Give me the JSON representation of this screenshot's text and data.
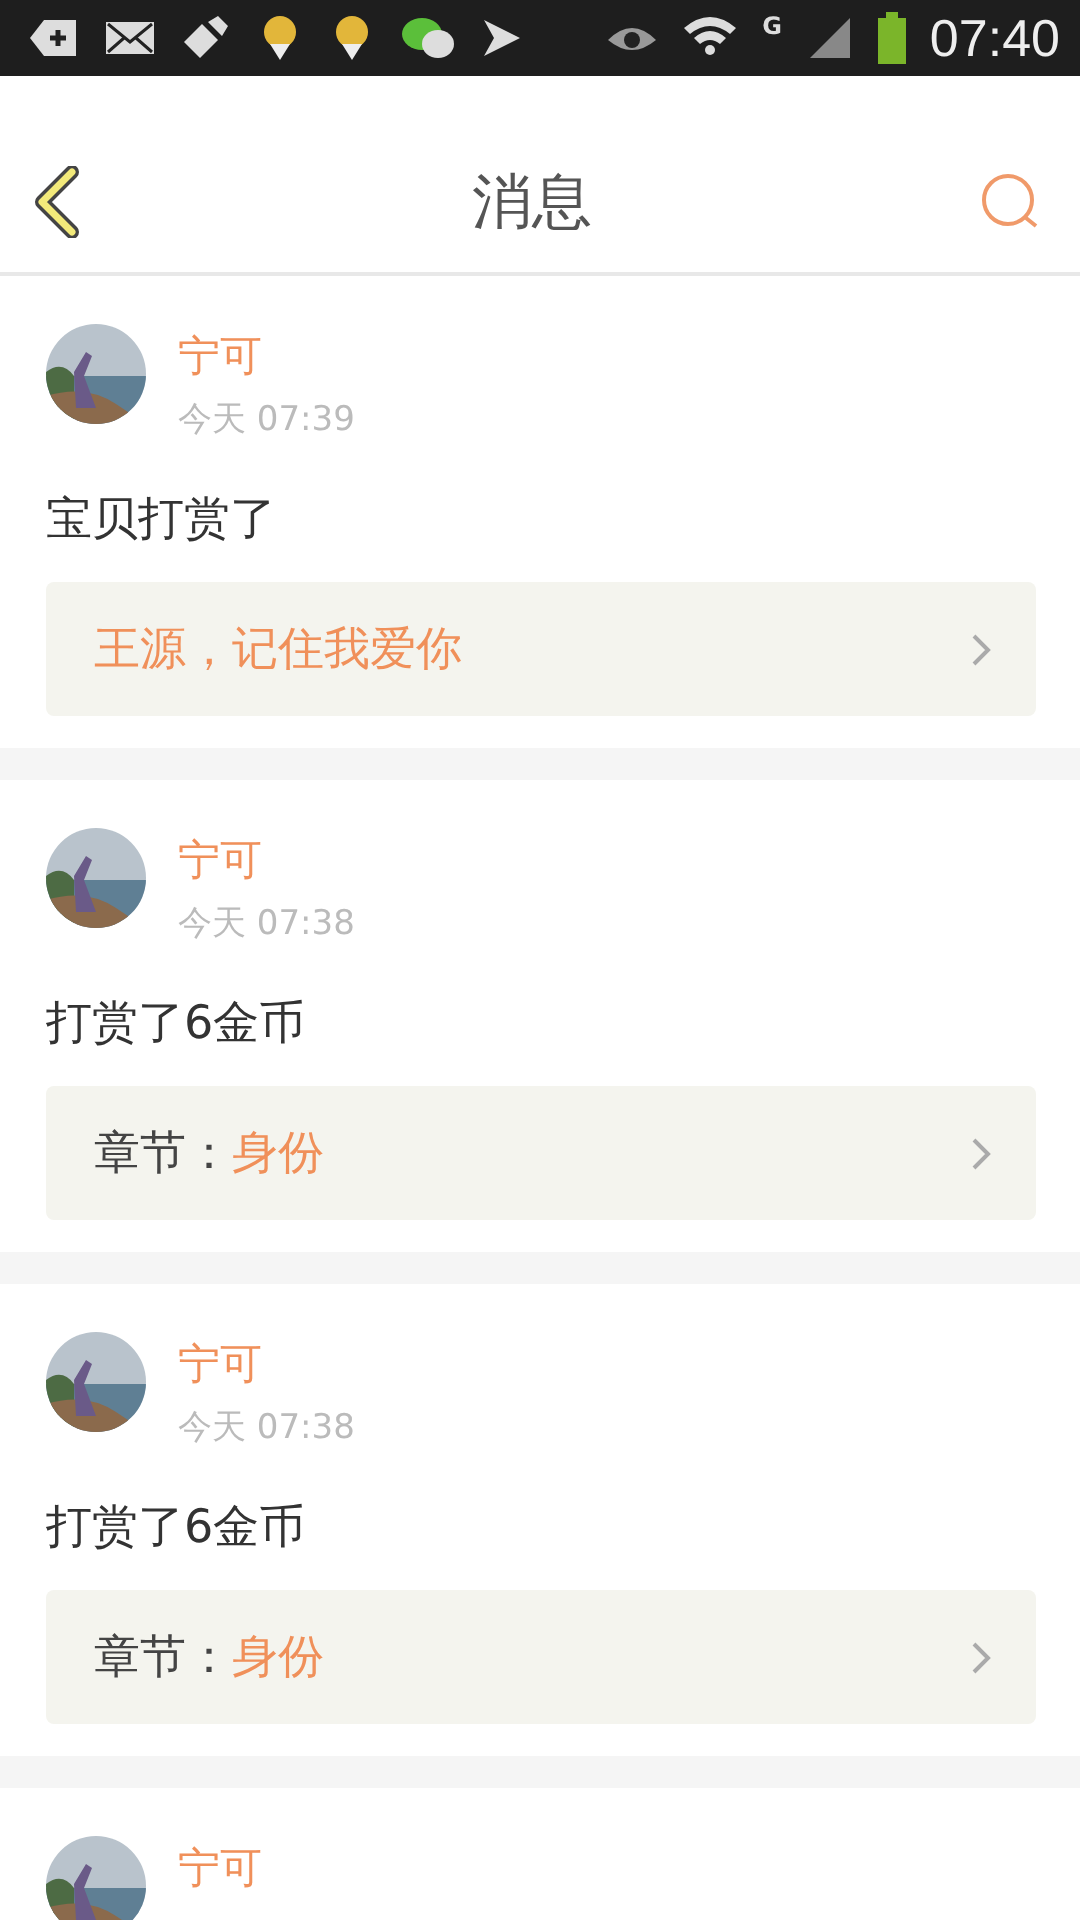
{
  "status_bar": {
    "network": "G",
    "time": "07:40"
  },
  "header": {
    "title": "消息"
  },
  "messages": [
    {
      "name": "宁可",
      "time": "今天 07:39",
      "body": "宝贝打赏了",
      "link": {
        "kind": "quote",
        "text": "王源，记住我爱你"
      }
    },
    {
      "name": "宁可",
      "time": "今天 07:38",
      "body": "打赏了6金币",
      "link": {
        "kind": "chapter",
        "label": "章节：",
        "value": "身份"
      }
    },
    {
      "name": "宁可",
      "time": "今天 07:38",
      "body": "打赏了6金币",
      "link": {
        "kind": "chapter",
        "label": "章节：",
        "value": "身份"
      }
    },
    {
      "name": "宁可"
    }
  ]
}
